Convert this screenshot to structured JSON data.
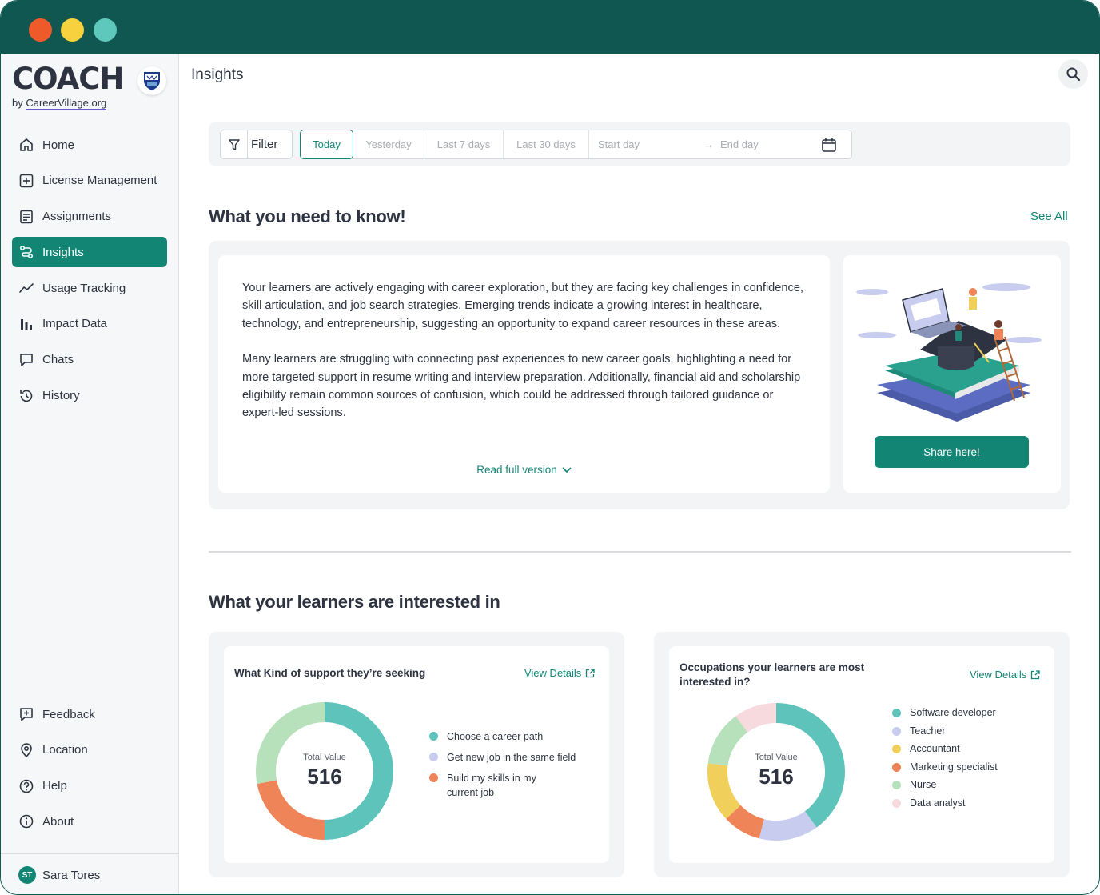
{
  "app": {
    "logo_main": "COACH",
    "logo_by": "by ",
    "logo_org": "CareerVillage.org"
  },
  "nav": {
    "items": [
      {
        "label": "Home",
        "icon": "home-icon"
      },
      {
        "label": "License Management",
        "icon": "plus-square-icon"
      },
      {
        "label": "Assignments",
        "icon": "document-icon"
      },
      {
        "label": "Insights",
        "icon": "route-icon",
        "active": true
      },
      {
        "label": "Usage Tracking",
        "icon": "trend-icon"
      },
      {
        "label": "Impact Data",
        "icon": "bar-chart-icon"
      },
      {
        "label": "Chats",
        "icon": "chat-icon"
      },
      {
        "label": "History",
        "icon": "history-icon"
      }
    ],
    "bottom_items": [
      {
        "label": "Feedback",
        "icon": "feedback-icon"
      },
      {
        "label": "Location",
        "icon": "location-icon"
      },
      {
        "label": "Help",
        "icon": "help-icon"
      },
      {
        "label": "About",
        "icon": "info-icon"
      }
    ]
  },
  "user": {
    "initials": "ST",
    "name": "Sara Tores"
  },
  "header": {
    "title": "Insights"
  },
  "filters": {
    "filter_label": "Filter",
    "ranges": [
      "Today",
      "Yesterday",
      "Last 7 days",
      "Last 30 days"
    ],
    "active_range": "Today",
    "start_placeholder": "Start day",
    "arrow": "→",
    "end_placeholder": "End day"
  },
  "know": {
    "title": "What you need to know!",
    "see_all": "See All",
    "paragraph1": "Your learners are actively engaging with career exploration, but they are facing key challenges in confidence, skill articulation, and job search strategies. Emerging trends indicate a growing interest in healthcare, technology, and entrepreneurship, suggesting an opportunity to expand career resources in these areas.",
    "paragraph2": "Many learners are struggling with connecting past experiences to new career goals, highlighting a need for more targeted support in resume writing and interview preparation. Additionally, financial aid and scholarship eligibility remain common sources of confusion, which could be addressed through tailored guidance or expert-led sessions.",
    "read_full": "Read full version",
    "share_label": "Share here!"
  },
  "interests": {
    "title": "What your learners are interested in",
    "view_details": "View Details"
  },
  "colors": {
    "primary": "#128575",
    "teal": "#5ec4bb",
    "lavender": "#c8cdf0",
    "yellow": "#f0cf5a",
    "orange": "#ee8458",
    "green": "#b7e1bb",
    "pink": "#f7dadd"
  },
  "chart_data": [
    {
      "type": "pie",
      "title": "What Kind of support they’re seeking",
      "center_label": "Total Value",
      "total": 516,
      "categories": [
        "Choose a career path",
        "Get new job in the same field",
        "Build my skills in my current job"
      ],
      "values": [
        0.5,
        0.28,
        0.22
      ],
      "slice_order": [
        "Choose a career path",
        "Build my skills in my current job",
        "Get new job in the same field"
      ],
      "colors": [
        "#5ec4bb",
        "#b7e1bb",
        "#ee8458"
      ],
      "legend_colors": [
        "#5ec4bb",
        "#c8cdf0",
        "#ee8458"
      ]
    },
    {
      "type": "pie",
      "title": "Occupations your learners are most interested in?",
      "center_label": "Total Value",
      "total": 516,
      "categories": [
        "Software developer",
        "Teacher",
        "Accountant",
        "Marketing specialist",
        "Nurse",
        "Data analyst"
      ],
      "values": [
        0.4,
        0.14,
        0.14,
        0.09,
        0.13,
        0.1
      ],
      "slice_order": [
        "Software developer",
        "Teacher",
        "Marketing specialist",
        "Accountant",
        "Nurse",
        "Data analyst"
      ],
      "colors": [
        "#5ec4bb",
        "#c8cdf0",
        "#f0cf5a",
        "#ee8458",
        "#b7e1bb",
        "#f7dadd"
      ]
    }
  ]
}
